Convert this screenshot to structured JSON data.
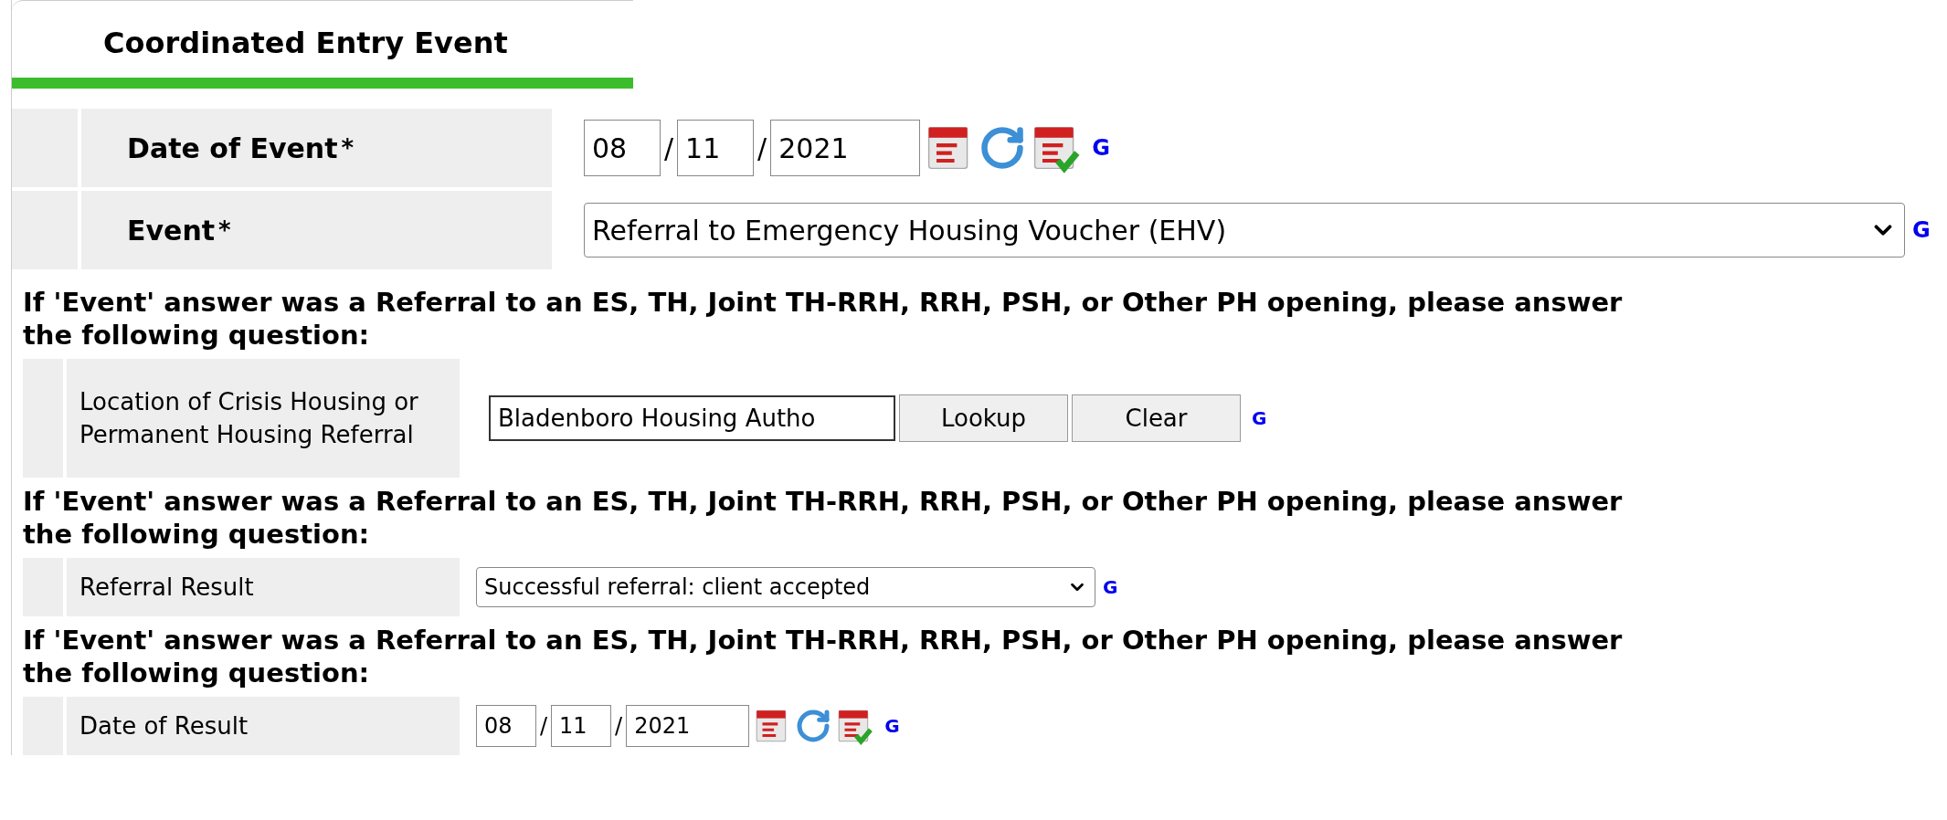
{
  "header": {
    "title": "Coordinated Entry Event"
  },
  "top_fields": [
    {
      "kind": "date",
      "label": "Date of Event",
      "required_mark": "*",
      "month": "08",
      "day": "11",
      "year": "2021",
      "separator": "/",
      "help": "G"
    },
    {
      "kind": "select",
      "label": "Event",
      "required_mark": "*",
      "value": "Referral to Emergency Housing Voucher (EHV)",
      "help": "G"
    }
  ],
  "sections": [
    {
      "instruction": "If 'Event' answer was a Referral to an ES, TH, Joint TH-RRH, RRH, PSH, or Other PH opening, please answer the following question:",
      "field": {
        "kind": "lookup",
        "label": "Location of Crisis Housing or Permanent Housing Referral",
        "value": "Bladenboro Housing Autho",
        "buttons": [
          "Lookup",
          "Clear"
        ],
        "help": "G"
      }
    },
    {
      "instruction": "If 'Event' answer was a Referral to an ES, TH, Joint TH-RRH, RRH, PSH, or Other PH opening, please answer the following question:",
      "field": {
        "kind": "select",
        "label": "Referral Result",
        "value": "Successful referral: client accepted",
        "help": "G"
      }
    },
    {
      "instruction": "If 'Event' answer was a Referral to an ES, TH, Joint TH-RRH, RRH, PSH, or Other PH opening, please answer the following question:",
      "field": {
        "kind": "date",
        "label": "Date of Result",
        "month": "08",
        "day": "11",
        "year": "2021",
        "separator": "/",
        "help": "G"
      }
    }
  ]
}
